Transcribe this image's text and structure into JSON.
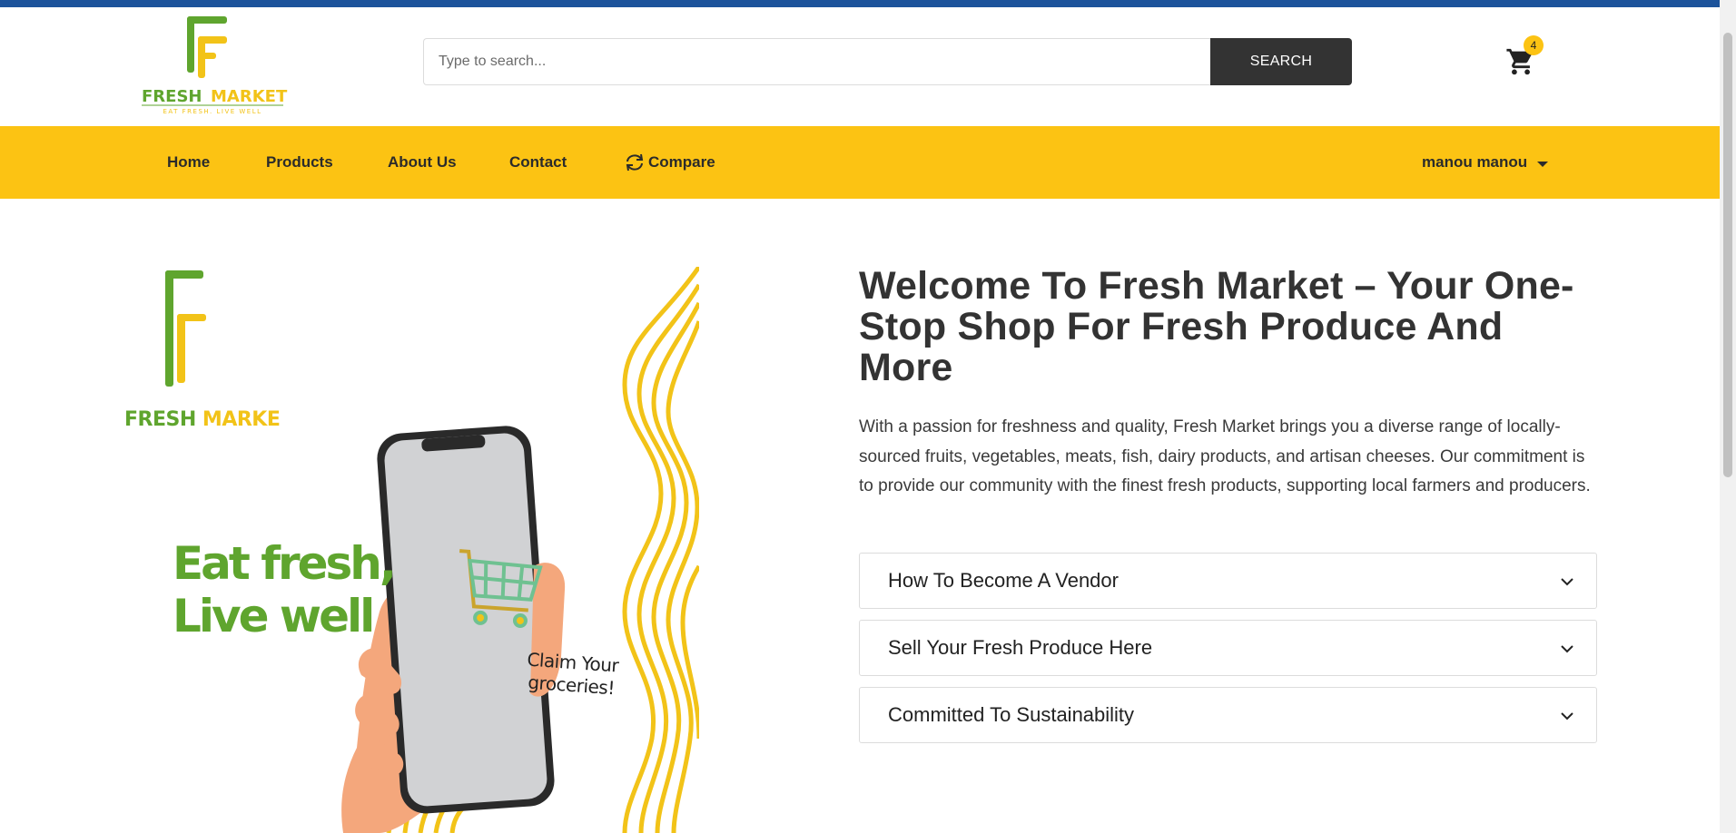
{
  "colors": {
    "top_stripe": "#1c539b",
    "nav_bg": "#fcc313",
    "brand_green": "#5fa52e",
    "brand_yellow": "#f2c318",
    "search_button": "#333333"
  },
  "header": {
    "logo": {
      "name": "FRESH MARKET",
      "tagline": "EAT FRESH. LIVE WELL"
    },
    "search": {
      "placeholder": "Type to search...",
      "value": "",
      "button_label": "SEARCH"
    },
    "cart": {
      "icon": "shopping-cart-icon",
      "count": "4"
    }
  },
  "nav": {
    "items": [
      {
        "label": "Home"
      },
      {
        "label": "Products"
      },
      {
        "label": "About Us"
      },
      {
        "label": "Contact"
      },
      {
        "label": "Compare",
        "icon": "refresh-icon"
      }
    ],
    "user": {
      "label": "manou manou",
      "icon": "caret-down-icon"
    }
  },
  "hero_image": {
    "brand": {
      "part1": "FRESH ",
      "part2": "MARKE"
    },
    "slogan_line1": "Eat fresh,",
    "slogan_line2": "Live well",
    "phone_text_line1": "Claim Your",
    "phone_text_line2": "groceries!"
  },
  "main": {
    "title": "Welcome To Fresh Market – Your One-Stop Shop For Fresh Produce And More",
    "description": "With a passion for freshness and quality, Fresh Market brings you a diverse range of locally-sourced fruits, vegetables, meats, fish, dairy products, and artisan cheeses. Our commitment is to provide our community with the finest fresh products, supporting local farmers and producers.",
    "accordion": [
      {
        "title": "How To Become A Vendor"
      },
      {
        "title": "Sell Your Fresh Produce Here"
      },
      {
        "title": "Committed To Sustainability"
      }
    ]
  }
}
